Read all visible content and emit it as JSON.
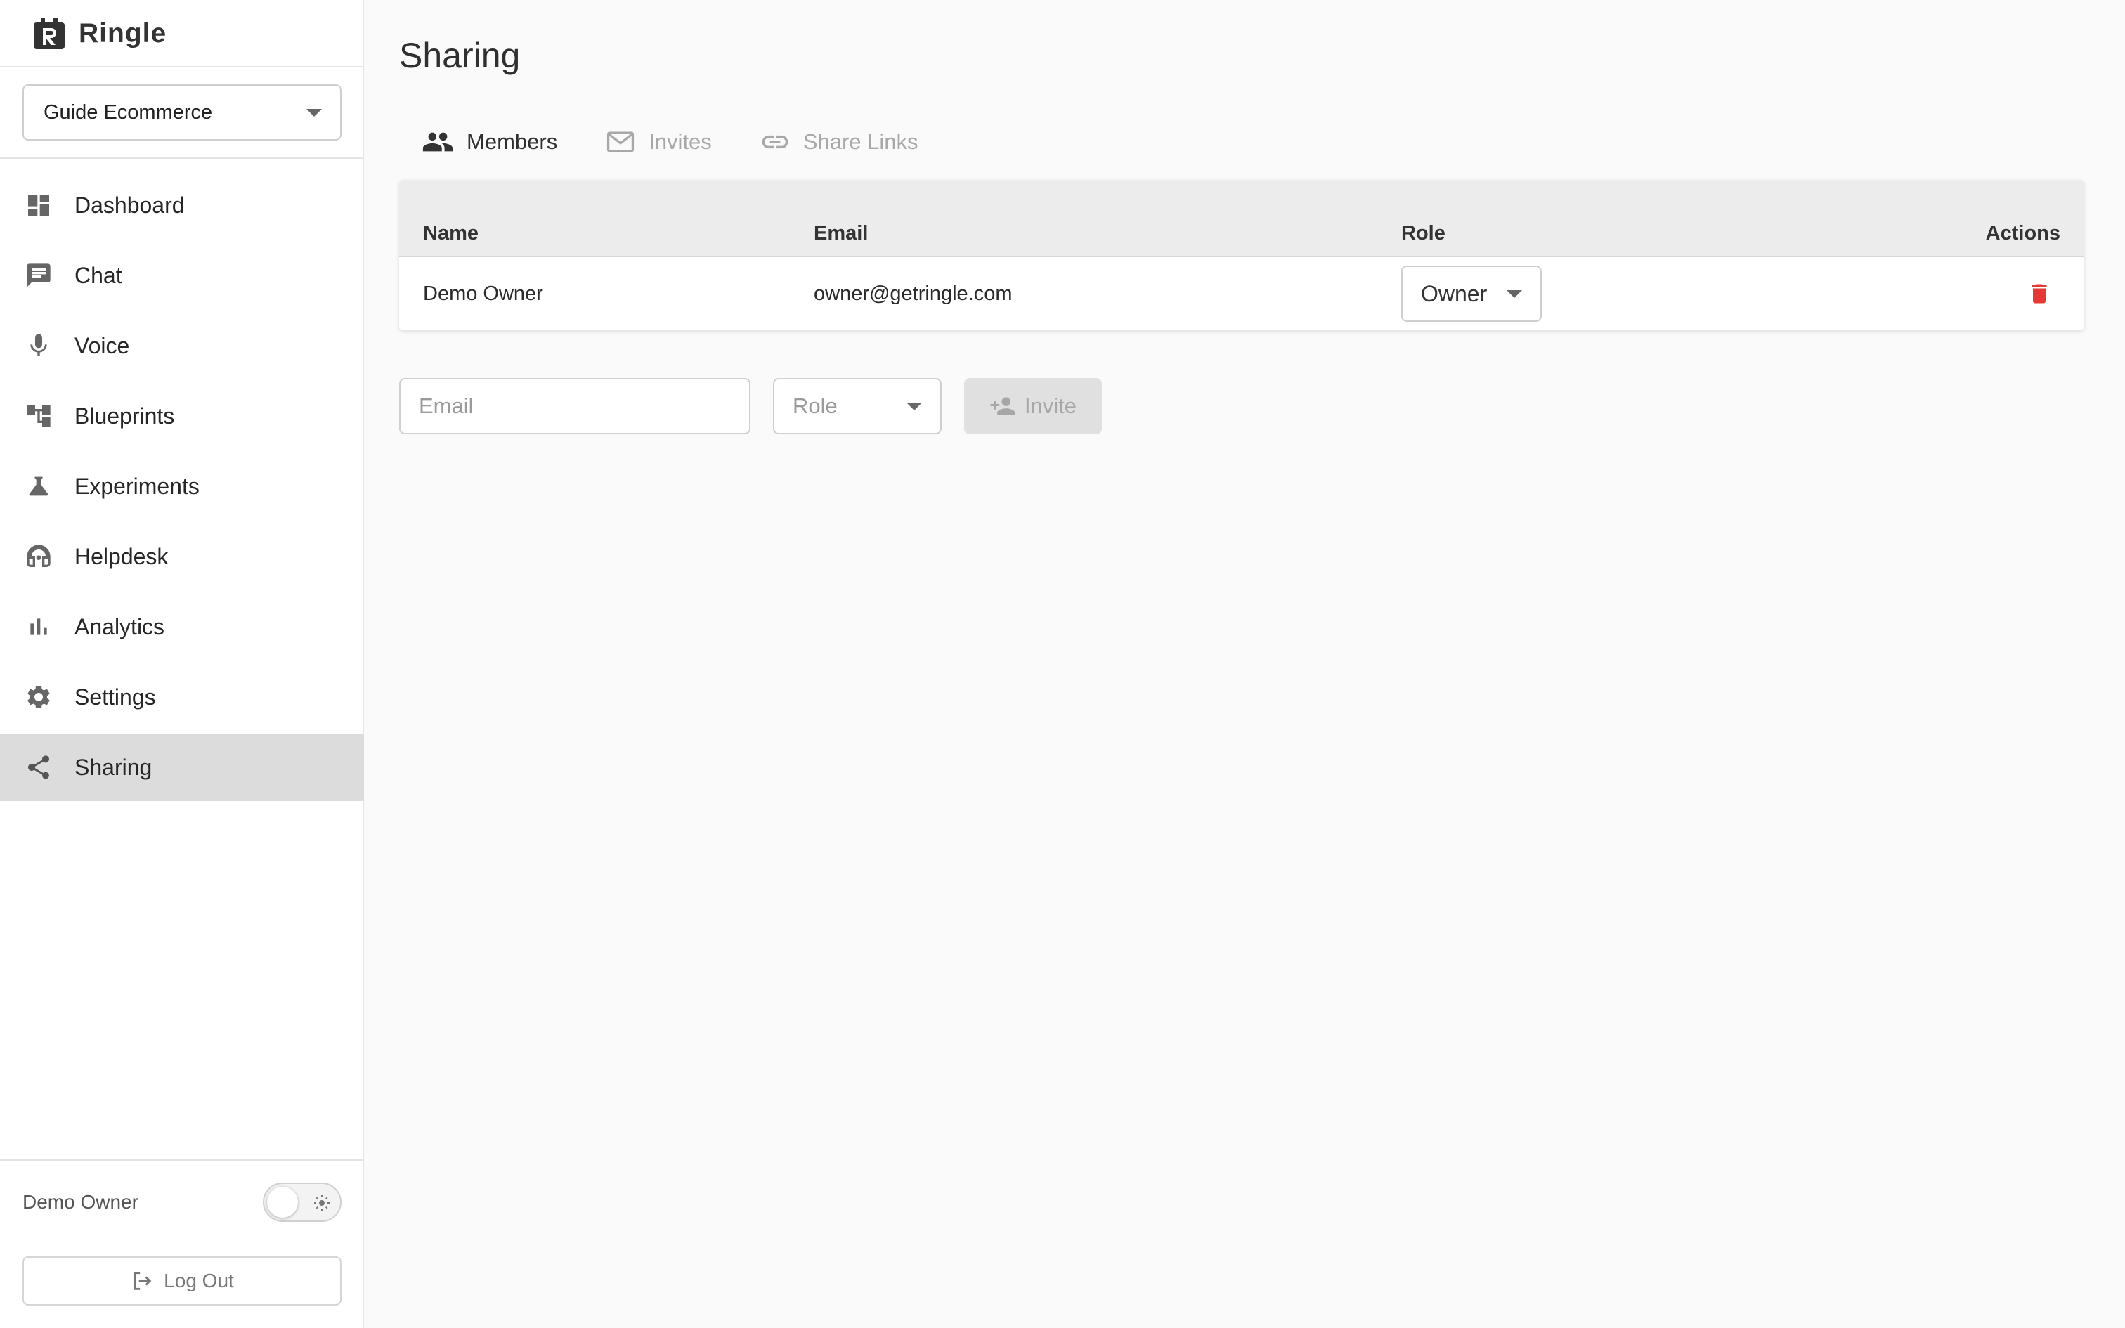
{
  "app": {
    "name": "Ringle"
  },
  "sidebar": {
    "project": "Guide Ecommerce",
    "items": [
      {
        "label": "Dashboard",
        "icon": "dashboard-icon"
      },
      {
        "label": "Chat",
        "icon": "chat-icon"
      },
      {
        "label": "Voice",
        "icon": "microphone-icon"
      },
      {
        "label": "Blueprints",
        "icon": "blueprint-icon"
      },
      {
        "label": "Experiments",
        "icon": "flask-icon"
      },
      {
        "label": "Helpdesk",
        "icon": "headset-icon"
      },
      {
        "label": "Analytics",
        "icon": "bar-chart-icon"
      },
      {
        "label": "Settings",
        "icon": "gear-icon"
      },
      {
        "label": "Sharing",
        "icon": "share-icon",
        "active": true
      }
    ],
    "user": "Demo Owner",
    "theme_toggle": "light",
    "logout_label": "Log Out"
  },
  "main": {
    "title": "Sharing",
    "tabs": [
      {
        "label": "Members",
        "icon": "people-icon",
        "active": true
      },
      {
        "label": "Invites",
        "icon": "mail-icon",
        "active": false
      },
      {
        "label": "Share Links",
        "icon": "link-icon",
        "active": false
      }
    ],
    "table": {
      "headers": {
        "name": "Name",
        "email": "Email",
        "role": "Role",
        "actions": "Actions"
      },
      "rows": [
        {
          "name": "Demo Owner",
          "email": "owner@getringle.com",
          "role": "Owner"
        }
      ]
    },
    "invite": {
      "email_placeholder": "Email",
      "role_placeholder": "Role",
      "button_label": "Invite"
    }
  },
  "colors": {
    "active_nav_bg": "#dcdcdc",
    "delete_red": "#e53935",
    "page_bg": "#fafafa"
  }
}
